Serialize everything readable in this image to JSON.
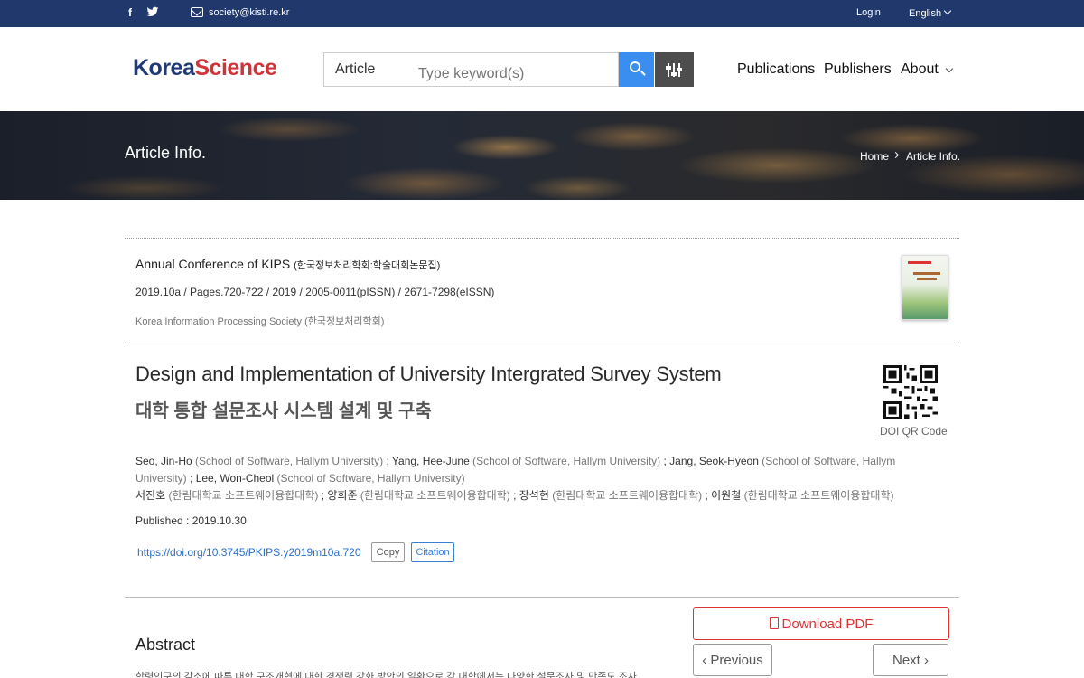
{
  "topbar": {
    "email": "society@kisti.re.kr",
    "login": "Login",
    "language": "English"
  },
  "header": {
    "logo_part1": "Korea",
    "logo_part2": "Science",
    "search_type": "Article",
    "search_placeholder": "Type keyword(s)",
    "nav": [
      "Publications",
      "Publishers",
      "About"
    ]
  },
  "banner": {
    "title": "Article Info.",
    "breadcrumb_home": "Home",
    "breadcrumb_current": "Article Info."
  },
  "article": {
    "journal_en": "Annual Conference of KIPS",
    "journal_ko": "(한국정보처리학회:학술대회논문집)",
    "issue_line": "2019.10a  /  Pages.720-722  /  2019  /  2005-0011(pISSN)  /  2671-7298(eISSN)",
    "publisher_line": "Korea Information Processing Society (한국정보처리학회)",
    "title_en": "Design and Implementation of University Intergrated Survey System",
    "title_ko": "대학 통합 설문조사 시스템 설계 및 구축",
    "qr_label": "DOI QR Code",
    "authors_en": [
      {
        "name": "Seo, Jin-Ho",
        "aff": "(School of Software, Hallym University)",
        "sep": " ; "
      },
      {
        "name": "Yang, Hee-June",
        "aff": "(School of Software, Hallym University)",
        "sep": " ; "
      },
      {
        "name": "Jang, Seok-Hyeon",
        "aff": "(School of Software, Hallym University)",
        "sep": " ;"
      },
      {
        "name": "Lee, Won-Cheol",
        "aff": "(School of Software, Hallym University)",
        "sep": ""
      }
    ],
    "authors_ko": [
      {
        "name": "서진호",
        "aff": "(한림대학교 소프트웨어융합대학)",
        "sep": " ; "
      },
      {
        "name": "양희준",
        "aff": "(한림대학교 소프트웨어융합대학)",
        "sep": " ; "
      },
      {
        "name": "장석현",
        "aff": "(한림대학교 소프트웨어융합대학)",
        "sep": " ; "
      },
      {
        "name": "이원철",
        "aff": "(한림대학교 소프트웨어융합대학)",
        "sep": ""
      }
    ],
    "published": "Published : 2019.10.30",
    "doi": "https://doi.org/10.3745/PKIPS.y2019m10a.720",
    "copy_label": "Copy",
    "citation_label": "Citation"
  },
  "abstract": {
    "heading": "Abstract",
    "text": "학령인구의 감소에 따른 대학 구조개혁에 대한 경쟁력 강화 방안의 일환으로 각 대학에서는 다양한 설문조사 및 만족도 조사"
  },
  "actions": {
    "download_pdf": "Download PDF",
    "previous": "Previous",
    "next": "Next"
  }
}
